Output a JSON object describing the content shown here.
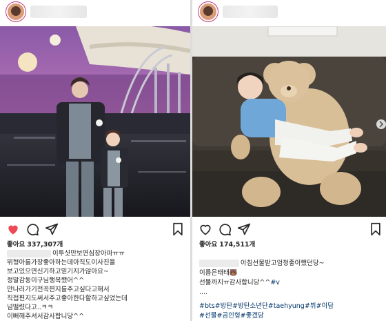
{
  "left_post": {
    "likes_label": "좋아요",
    "likes_count": "337,307개",
    "caption_first": "이투샷만보면심장아파ㅠㅠ",
    "caption_lines": [
      "뷔형아를가장좋아하는데아직도이사진을",
      "보고있으면신기하고믿기지가않아요~",
      "정말감동이구님행복했어^^",
      "만나러가기전꼭편지를주고싶다고해서",
      "직접편지도써서주고좋아한다할하고싶었는데",
      "넘떨렸다고..ㅋㅋ",
      "이뻐해주셔서감사합니당^^"
    ],
    "liked": true
  },
  "right_post": {
    "likes_label": "좋아요",
    "likes_count": "174,511개",
    "caption_first": "아침선물받고엄청좋아했던당~",
    "caption_lines": [
      "이름은태태🐻",
      "선물까지ㅠ감사합니당^^"
    ],
    "caption_tag_v": "#v",
    "dots": "....",
    "hashtags_line1": "#bts#방탄#방탄소년단#taehyung#뷔#이담",
    "hashtags_line2": "#선물#곰인형#좋겠당",
    "liked": false
  },
  "colors": {
    "like_red": "#ed4956",
    "hashtag": "#003569",
    "story_ring": "#c43b7e"
  },
  "icons": [
    "heart-icon",
    "comment-icon",
    "share-icon",
    "bookmark-icon",
    "chevron-right-icon"
  ]
}
